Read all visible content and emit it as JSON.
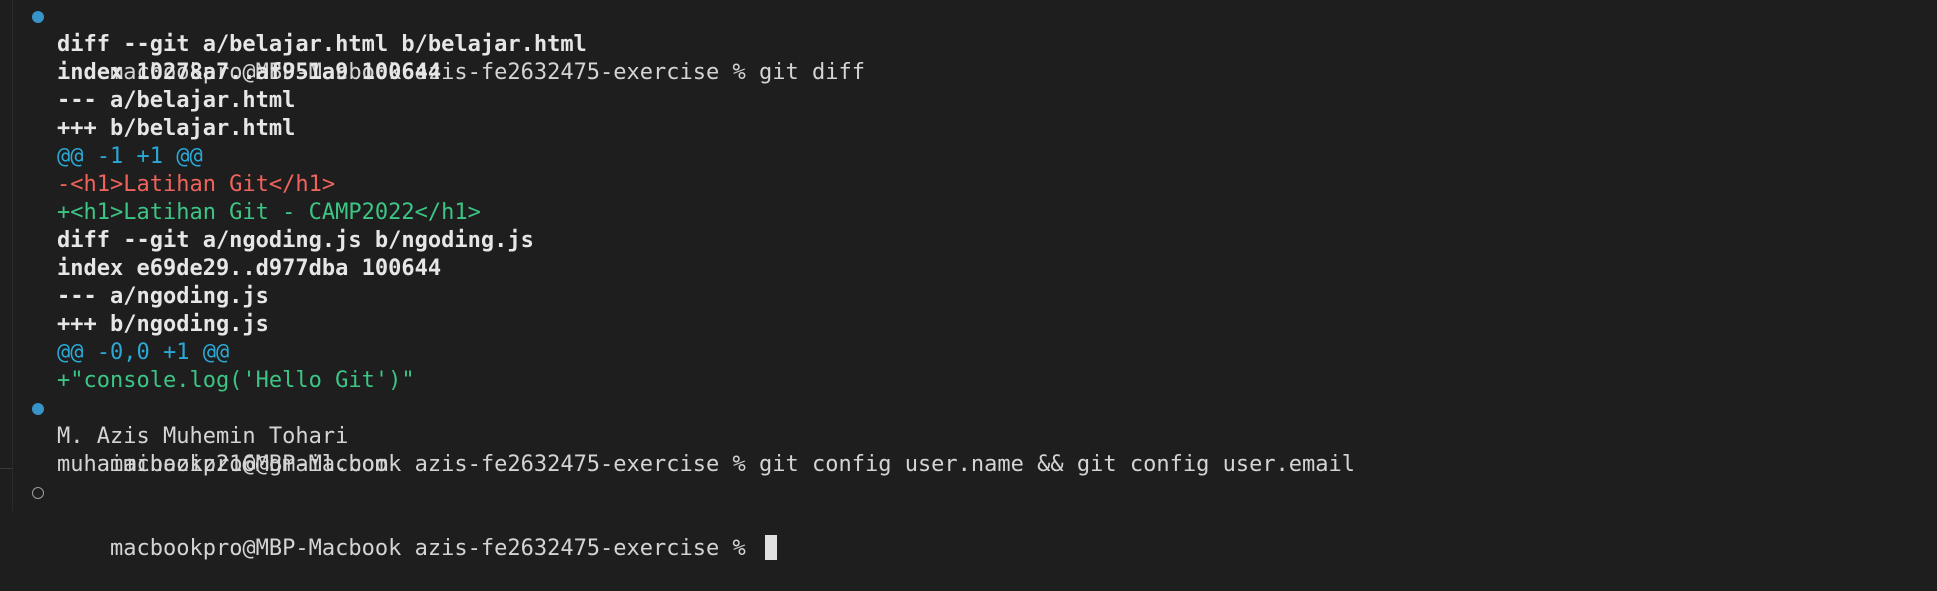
{
  "terminal": {
    "colors": {
      "background": "#1e1e1e",
      "foreground": "#d4d4d4",
      "hunk": "#2aa8d6",
      "removed": "#f0635c",
      "added": "#3cc584",
      "success_marker": "#3794c8"
    },
    "cmd1": {
      "prompt": "macbookpro@MBP-Macbook azis-fe2632475-exercise % ",
      "command": "git diff",
      "status_marker": "success-circle-icon"
    },
    "diff1": {
      "header": "diff --git a/belajar.html b/belajar.html",
      "index": "index 10278a7..af951a9 100644",
      "old_file": "--- a/belajar.html",
      "new_file": "+++ b/belajar.html",
      "hunk": "@@ -1 +1 @@",
      "removed": "-<h1>Latihan Git</h1>",
      "added": "+<h1>Latihan Git - CAMP2022</h1>"
    },
    "diff2": {
      "header": "diff --git a/ngoding.js b/ngoding.js",
      "index": "index e69de29..d977dba 100644",
      "old_file": "--- a/ngoding.js",
      "new_file": "+++ b/ngoding.js",
      "hunk": "@@ -0,0 +1 @@",
      "added": "+\"console.log('Hello Git')\""
    },
    "cmd2": {
      "prompt": "macbookpro@MBP-Macbook azis-fe2632475-exercise % ",
      "command": "git config user.name && git config user.email",
      "status_marker": "success-circle-icon",
      "output": [
        "M. Azis Muhemin Tohari",
        "muhaiminaziz216@gmail.com"
      ]
    },
    "cmd3": {
      "prompt": "macbookpro@MBP-Macbook azis-fe2632475-exercise % ",
      "command": "",
      "status_marker": "pending-circle-icon"
    }
  }
}
